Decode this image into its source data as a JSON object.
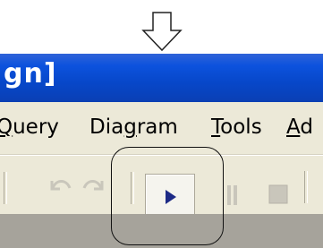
{
  "window": {
    "title_fragment": "gn]"
  },
  "menu": {
    "items": [
      {
        "pre": "",
        "acc": "Q",
        "post": "uery"
      },
      {
        "pre": "Dia",
        "acc": "g",
        "post": "ram"
      },
      {
        "pre": "",
        "acc": "T",
        "post": "ools"
      },
      {
        "pre": "",
        "acc": "A",
        "post": "d"
      }
    ]
  },
  "toolbar": {
    "buttons": [
      {
        "name": "undo",
        "icon": "undo-arrow-icon",
        "enabled": false
      },
      {
        "name": "redo",
        "icon": "redo-arrow-icon",
        "enabled": false
      },
      {
        "name": "run",
        "icon": "play-triangle-icon",
        "enabled": true
      },
      {
        "name": "pause",
        "icon": "pause-icon",
        "enabled": false
      },
      {
        "name": "stop",
        "icon": "stop-square-icon",
        "enabled": false
      }
    ]
  },
  "colors": {
    "titlebar": "#0a4fd7",
    "menubar": "#ece9d8",
    "run_icon": "#1d2a86",
    "disabled_icon": "#c9c6bb"
  }
}
